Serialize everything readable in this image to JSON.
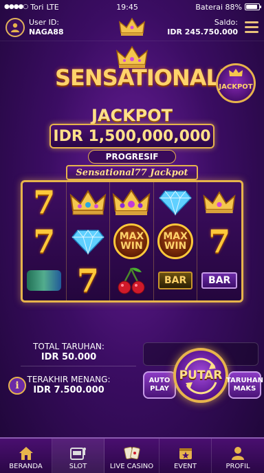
{
  "status_bar": {
    "carrier": "Tori",
    "network": "LTE",
    "time": "19:45",
    "battery_text": "Baterai 88%",
    "battery_level": 0.88
  },
  "header": {
    "user_id_label": "User ID:",
    "user_id_value": "NAGA88",
    "saldo_label": "Saldo:",
    "saldo_value": "IDR 245.750.000"
  },
  "logo": {
    "text": "SENSATIONAL77",
    "badge_text": "JACKPOT"
  },
  "jackpot": {
    "title": "JACKPOT",
    "amount": "IDR 1,500,000,000",
    "type": "PROGRESIF",
    "reel_title": "Sensational77 Jackpot"
  },
  "reels": {
    "rows": [
      [
        "seven",
        "crown-gold",
        "crown-purple",
        "diamond",
        "crown-gold"
      ],
      [
        "seven",
        "diamond",
        "max-win",
        "max-win",
        "seven"
      ],
      [
        "blurred-symbol",
        "seven",
        "cherry",
        "bar-gold",
        "bar-purple"
      ]
    ],
    "max_win_line1": "MAX",
    "max_win_line2": "WIN",
    "bar_label": "BAR"
  },
  "controls": {
    "total_bet_label": "TOTAL TARUHAN:",
    "total_bet_value": "IDR 50.000",
    "last_win_label": "TERAKHIR MENANG:",
    "last_win_value": "IDR 7.500.000",
    "info_label": "i",
    "auto_play_line1": "AUTO",
    "auto_play_line2": "PLAY",
    "spin_label": "PUTAR",
    "max_bet_line1": "TARUHAN",
    "max_bet_line2": "MAKS"
  },
  "nav": {
    "items": [
      {
        "label": "BERANDA",
        "icon": "home-icon"
      },
      {
        "label": "SLOT",
        "icon": "slot-machine-icon",
        "active": true
      },
      {
        "label": "LIVE CASINO",
        "icon": "cards-icon"
      },
      {
        "label": "EVENT",
        "icon": "calendar-star-icon"
      },
      {
        "label": "PROFIL",
        "icon": "user-icon"
      }
    ]
  },
  "colors": {
    "gold": "#e7b44c",
    "bg_purple": "#3b0d63",
    "accent_purple": "#6b2aa6"
  }
}
